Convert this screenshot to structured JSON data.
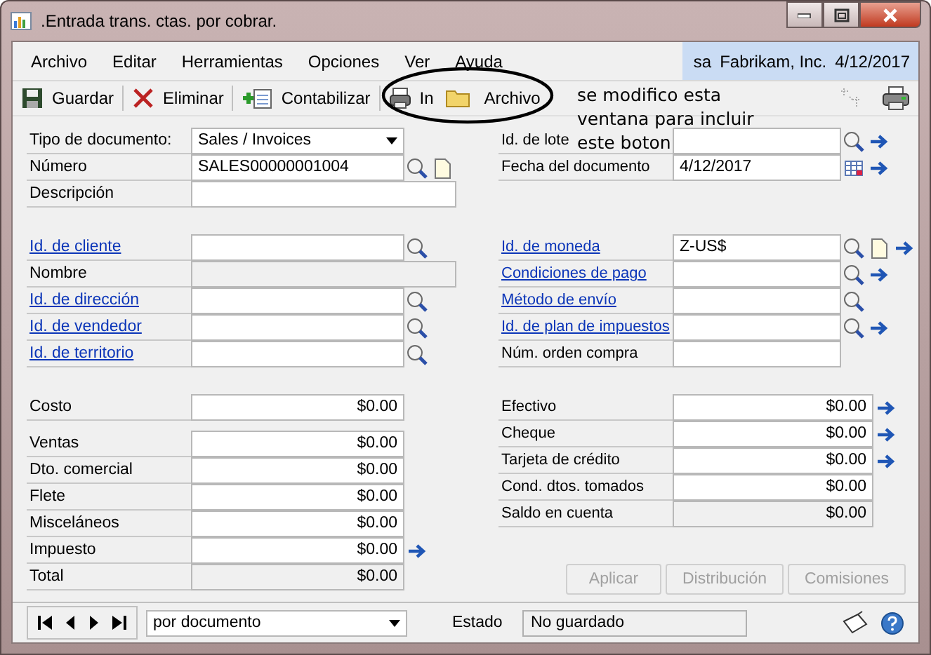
{
  "window": {
    "title": ".Entrada trans. ctas. por cobrar."
  },
  "menu": [
    "Archivo",
    "Editar",
    "Herramientas",
    "Opciones",
    "Ver",
    "Ayuda"
  ],
  "session": {
    "user": "sa",
    "company": "Fabrikam, Inc.",
    "date": "4/12/2017"
  },
  "toolbar": [
    "Guardar",
    "Eliminar",
    "Contabilizar",
    "In",
    "Archivo"
  ],
  "annotation": {
    "lines": [
      "se modifico esta",
      "ventana para incluir",
      "este boton"
    ]
  },
  "header_left": [
    {
      "label": "Tipo de documento:",
      "link": false,
      "kind": "dropdown",
      "value": "Sales / Invoices"
    },
    {
      "label": "Número",
      "link": false,
      "kind": "text",
      "value": "SALES00000001004"
    },
    {
      "label": "Descripción",
      "link": false,
      "kind": "wide"
    }
  ],
  "header_right": [
    {
      "label": "Id. de lote",
      "link": false,
      "kind": "text"
    },
    {
      "label": "Fecha del documento",
      "link": false,
      "kind": "text",
      "value": "4/12/2017"
    }
  ],
  "customer_left": [
    {
      "label": "Id. de cliente",
      "link": true,
      "kind": "text"
    },
    {
      "label": "Nombre",
      "link": false,
      "kind": "readonly-wide"
    },
    {
      "label": "Id. de dirección",
      "link": true,
      "kind": "text"
    },
    {
      "label": "Id. de vendedor",
      "link": true,
      "kind": "text"
    },
    {
      "label": "Id. de territorio",
      "link": true,
      "kind": "text"
    }
  ],
  "customer_right": [
    {
      "label": "Id. de moneda",
      "link": true,
      "kind": "text",
      "value": "Z-US$"
    },
    {
      "label": "Condiciones de pago",
      "link": true,
      "kind": "text"
    },
    {
      "label": "Método de envío",
      "link": true,
      "kind": "text"
    },
    {
      "label": "Id. de plan de impuestos",
      "link": true,
      "kind": "text"
    },
    {
      "label": "Núm. orden compra",
      "link": false,
      "kind": "text"
    }
  ],
  "cost": {
    "label": "Costo",
    "kind": "amount",
    "value": "$0.00"
  },
  "amounts_left": [
    {
      "label": "Ventas",
      "kind": "amount",
      "value": "$0.00"
    },
    {
      "label": "Dto. comercial",
      "kind": "amount",
      "value": "$0.00"
    },
    {
      "label": "Flete",
      "kind": "amount",
      "value": "$0.00"
    },
    {
      "label": "Misceláneos",
      "kind": "amount",
      "value": "$0.00"
    },
    {
      "label": "Impuesto",
      "kind": "amount",
      "value": "$0.00"
    },
    {
      "label": "Total",
      "kind": "readonly-amount",
      "value": "$0.00"
    }
  ],
  "amounts_right": [
    {
      "label": "Efectivo",
      "kind": "amount",
      "value": "$0.00"
    },
    {
      "label": "Cheque",
      "kind": "amount",
      "value": "$0.00"
    },
    {
      "label": "Tarjeta de crédito",
      "kind": "amount",
      "value": "$0.00"
    },
    {
      "label": "Cond. dtos. tomados",
      "kind": "amount",
      "value": "$0.00"
    },
    {
      "label": "Saldo en cuenta",
      "kind": "readonly-amount",
      "value": "$0.00"
    }
  ],
  "actions": [
    {
      "label": "Aplicar",
      "disabled": true
    },
    {
      "label": "Distribución",
      "disabled": true
    },
    {
      "label": "Comisiones",
      "disabled": true
    }
  ],
  "footer": {
    "browse": "por documento",
    "status_label": "Estado",
    "status": "No guardado"
  }
}
